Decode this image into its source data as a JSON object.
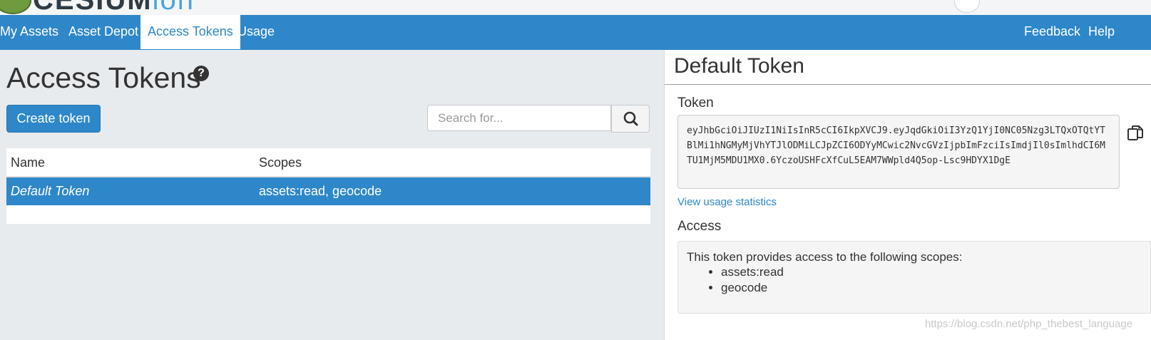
{
  "brand": {
    "name": "CESIUM",
    "suffix": "ion"
  },
  "nav": {
    "items": [
      {
        "label": "My Assets"
      },
      {
        "label": "Asset Depot"
      },
      {
        "label": "Access Tokens",
        "active": true
      },
      {
        "label": "Usage"
      }
    ],
    "right_items": [
      {
        "label": "Feedback"
      },
      {
        "label": "Help"
      }
    ]
  },
  "page": {
    "title": "Access Tokens",
    "help_glyph": "?",
    "create_button": "Create token",
    "search": {
      "placeholder": "Search for...",
      "value": ""
    }
  },
  "table": {
    "columns": [
      "Name",
      "Scopes"
    ],
    "rows": [
      {
        "name": "Default Token",
        "scopes": "assets:read, geocode",
        "selected": true
      }
    ]
  },
  "detail": {
    "title": "Default Token",
    "token_label": "Token",
    "token": "eyJhbGciOiJIUzI1NiIsInR5cCI6IkpXVCJ9.eyJqdGkiOiI3YzQ1YjI0NC05Nzg3LTQxOTQtYTBlMi1hNGMyMjVhYTJlODMiLCJpZCI6ODYyMCwic2NvcGVzIjpbImFzciIsImdjIl0sImlhdCI6MTU1MjM5MDU1MX0.6YczoUSHFcXfCuL5EAM7WWpld4Q5op-Lsc9HDYX1DgE",
    "usage_link": "View usage statistics",
    "access_label": "Access",
    "access_intro": "This token provides access to the following scopes:",
    "scopes": [
      "assets:read",
      "geocode"
    ]
  },
  "watermark": "https://blog.csdn.net/php_thebest_language",
  "colors": {
    "accent": "#2e87c8",
    "background": "#e8ebee"
  }
}
